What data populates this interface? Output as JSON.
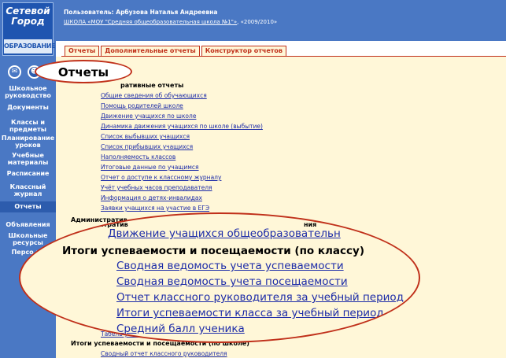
{
  "logo": {
    "line1": "Сетевой",
    "line2": "Город",
    "line3": "ОБРАЗОВАНИЕ"
  },
  "sidebar": {
    "icons": [
      "mail-icon",
      "forum-icon"
    ],
    "items": [
      {
        "label": "Школьное руководство",
        "active": false
      },
      {
        "label": "Документы",
        "active": false
      },
      {
        "label": "Классы и предметы",
        "active": false
      },
      {
        "label": "Планирование уроков",
        "active": false
      },
      {
        "label": "Учебные материалы",
        "active": false
      },
      {
        "label": "Расписание",
        "active": false
      },
      {
        "label": "Классный журнал",
        "active": false
      },
      {
        "label": "Отчеты",
        "active": true
      },
      {
        "label": "Объявления",
        "active": false
      },
      {
        "label": "Школьные ресурсы",
        "active": false
      },
      {
        "label": "Персо на",
        "active": false
      }
    ]
  },
  "header": {
    "user_line": "Пользователь: Арбузова Наталья Андреевна",
    "school_link": "ШКОЛА «МОУ \"Средняя общеобразовательная школа №1\"»",
    "school_suffix": ", «2009/2010»"
  },
  "tabs": [
    {
      "label": "Отчеты"
    },
    {
      "label": "Дополнительные отчеты"
    },
    {
      "label": "Конструктор отчетов"
    }
  ],
  "page_title": "Отчеты",
  "sections": {
    "administrative": {
      "title": "ративные отчеты",
      "links": [
        "Общие сведения об обучающихся",
        "Помощь родителей школе",
        "Движение учащихся по школе",
        "Динамика движения учащихся по школе (выбытие)",
        "Список выбывших учащихся",
        "Список прибывших учащихся",
        "Наполняемость классов",
        "Итоговые данные по учащимся",
        "Отчет о доступе к классному журналу",
        "Учёт учебных часов преподавателя",
        "Информация о детях-инвалидах",
        "Заявки учащихся на участие в ЕГЭ"
      ]
    },
    "admin_reports_label": "Административ",
    "admin_reports_tail": "ния",
    "progress_class": {
      "title": "Итоги успеваемости и посещаемости (по классу)",
      "top_link": "Движение учащихся общеобразовательн",
      "links": [
        "Сводная ведомость учета успеваемости",
        "Сводная ведомость учета посещаемости",
        "Отчет классного руководителя за учебный период",
        "Итоги успеваемости класса за учебный период",
        "Средний балл ученика"
      ]
    },
    "partial_link": "Табель успе",
    "progress_school": {
      "title": "Итоги успеваемости и посещаемости (по школе)",
      "links": [
        "Сводный отчет классного руководителя"
      ]
    }
  }
}
